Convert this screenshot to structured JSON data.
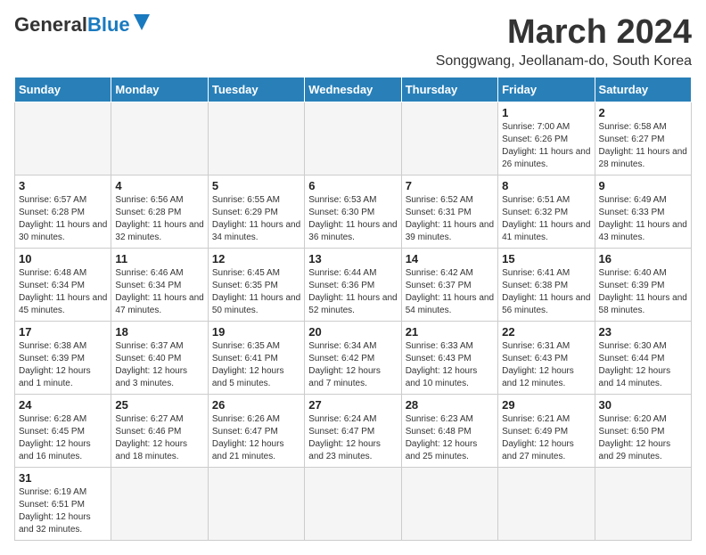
{
  "logo": {
    "name_part1": "General",
    "name_part2": "Blue",
    "sub": "Blue"
  },
  "title": {
    "month_year": "March 2024",
    "location": "Songgwang, Jeollanam-do, South Korea"
  },
  "headers": [
    "Sunday",
    "Monday",
    "Tuesday",
    "Wednesday",
    "Thursday",
    "Friday",
    "Saturday"
  ],
  "weeks": [
    [
      {
        "day": "",
        "info": ""
      },
      {
        "day": "",
        "info": ""
      },
      {
        "day": "",
        "info": ""
      },
      {
        "day": "",
        "info": ""
      },
      {
        "day": "",
        "info": ""
      },
      {
        "day": "1",
        "info": "Sunrise: 7:00 AM\nSunset: 6:26 PM\nDaylight: 11 hours and 26 minutes."
      },
      {
        "day": "2",
        "info": "Sunrise: 6:58 AM\nSunset: 6:27 PM\nDaylight: 11 hours and 28 minutes."
      }
    ],
    [
      {
        "day": "3",
        "info": "Sunrise: 6:57 AM\nSunset: 6:28 PM\nDaylight: 11 hours and 30 minutes."
      },
      {
        "day": "4",
        "info": "Sunrise: 6:56 AM\nSunset: 6:28 PM\nDaylight: 11 hours and 32 minutes."
      },
      {
        "day": "5",
        "info": "Sunrise: 6:55 AM\nSunset: 6:29 PM\nDaylight: 11 hours and 34 minutes."
      },
      {
        "day": "6",
        "info": "Sunrise: 6:53 AM\nSunset: 6:30 PM\nDaylight: 11 hours and 36 minutes."
      },
      {
        "day": "7",
        "info": "Sunrise: 6:52 AM\nSunset: 6:31 PM\nDaylight: 11 hours and 39 minutes."
      },
      {
        "day": "8",
        "info": "Sunrise: 6:51 AM\nSunset: 6:32 PM\nDaylight: 11 hours and 41 minutes."
      },
      {
        "day": "9",
        "info": "Sunrise: 6:49 AM\nSunset: 6:33 PM\nDaylight: 11 hours and 43 minutes."
      }
    ],
    [
      {
        "day": "10",
        "info": "Sunrise: 6:48 AM\nSunset: 6:34 PM\nDaylight: 11 hours and 45 minutes."
      },
      {
        "day": "11",
        "info": "Sunrise: 6:46 AM\nSunset: 6:34 PM\nDaylight: 11 hours and 47 minutes."
      },
      {
        "day": "12",
        "info": "Sunrise: 6:45 AM\nSunset: 6:35 PM\nDaylight: 11 hours and 50 minutes."
      },
      {
        "day": "13",
        "info": "Sunrise: 6:44 AM\nSunset: 6:36 PM\nDaylight: 11 hours and 52 minutes."
      },
      {
        "day": "14",
        "info": "Sunrise: 6:42 AM\nSunset: 6:37 PM\nDaylight: 11 hours and 54 minutes."
      },
      {
        "day": "15",
        "info": "Sunrise: 6:41 AM\nSunset: 6:38 PM\nDaylight: 11 hours and 56 minutes."
      },
      {
        "day": "16",
        "info": "Sunrise: 6:40 AM\nSunset: 6:39 PM\nDaylight: 11 hours and 58 minutes."
      }
    ],
    [
      {
        "day": "17",
        "info": "Sunrise: 6:38 AM\nSunset: 6:39 PM\nDaylight: 12 hours and 1 minute."
      },
      {
        "day": "18",
        "info": "Sunrise: 6:37 AM\nSunset: 6:40 PM\nDaylight: 12 hours and 3 minutes."
      },
      {
        "day": "19",
        "info": "Sunrise: 6:35 AM\nSunset: 6:41 PM\nDaylight: 12 hours and 5 minutes."
      },
      {
        "day": "20",
        "info": "Sunrise: 6:34 AM\nSunset: 6:42 PM\nDaylight: 12 hours and 7 minutes."
      },
      {
        "day": "21",
        "info": "Sunrise: 6:33 AM\nSunset: 6:43 PM\nDaylight: 12 hours and 10 minutes."
      },
      {
        "day": "22",
        "info": "Sunrise: 6:31 AM\nSunset: 6:43 PM\nDaylight: 12 hours and 12 minutes."
      },
      {
        "day": "23",
        "info": "Sunrise: 6:30 AM\nSunset: 6:44 PM\nDaylight: 12 hours and 14 minutes."
      }
    ],
    [
      {
        "day": "24",
        "info": "Sunrise: 6:28 AM\nSunset: 6:45 PM\nDaylight: 12 hours and 16 minutes."
      },
      {
        "day": "25",
        "info": "Sunrise: 6:27 AM\nSunset: 6:46 PM\nDaylight: 12 hours and 18 minutes."
      },
      {
        "day": "26",
        "info": "Sunrise: 6:26 AM\nSunset: 6:47 PM\nDaylight: 12 hours and 21 minutes."
      },
      {
        "day": "27",
        "info": "Sunrise: 6:24 AM\nSunset: 6:47 PM\nDaylight: 12 hours and 23 minutes."
      },
      {
        "day": "28",
        "info": "Sunrise: 6:23 AM\nSunset: 6:48 PM\nDaylight: 12 hours and 25 minutes."
      },
      {
        "day": "29",
        "info": "Sunrise: 6:21 AM\nSunset: 6:49 PM\nDaylight: 12 hours and 27 minutes."
      },
      {
        "day": "30",
        "info": "Sunrise: 6:20 AM\nSunset: 6:50 PM\nDaylight: 12 hours and 29 minutes."
      }
    ],
    [
      {
        "day": "31",
        "info": "Sunrise: 6:19 AM\nSunset: 6:51 PM\nDaylight: 12 hours and 32 minutes."
      },
      {
        "day": "",
        "info": ""
      },
      {
        "day": "",
        "info": ""
      },
      {
        "day": "",
        "info": ""
      },
      {
        "day": "",
        "info": ""
      },
      {
        "day": "",
        "info": ""
      },
      {
        "day": "",
        "info": ""
      }
    ]
  ]
}
